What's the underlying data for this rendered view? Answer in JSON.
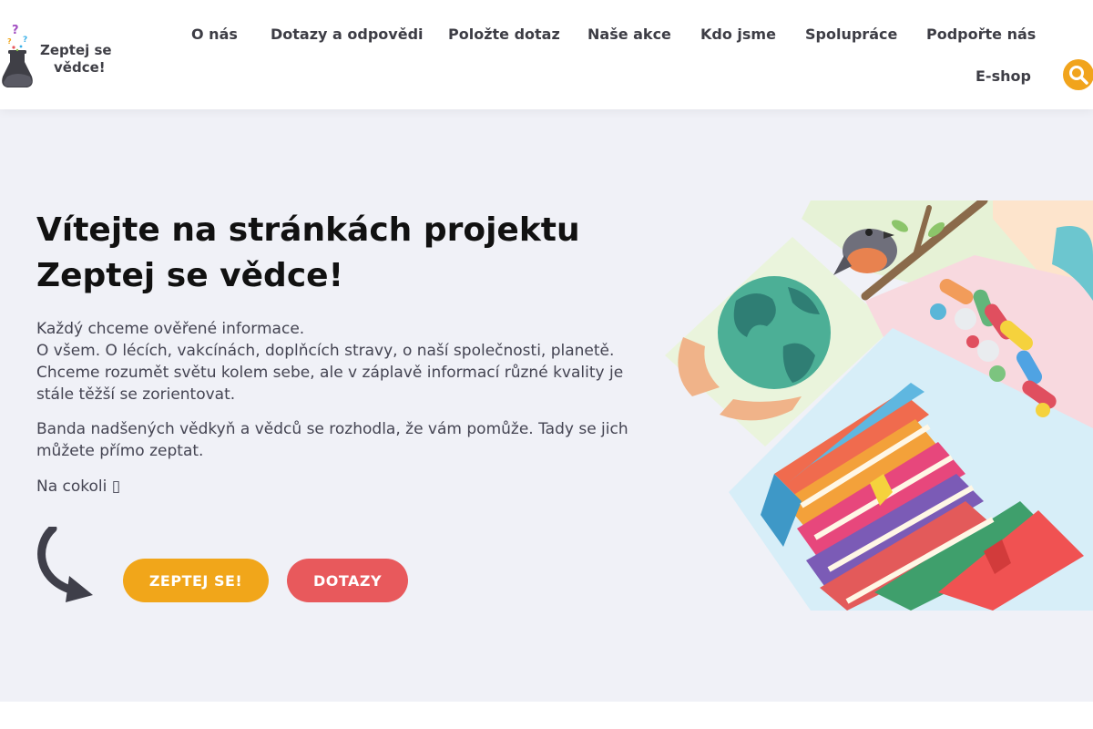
{
  "brand": {
    "name_line1": "Zeptej se",
    "name_line2": "vědce!"
  },
  "nav": {
    "items": [
      {
        "label": "O nás"
      },
      {
        "label": "Dotazy a odpovědi"
      },
      {
        "label": "Položte dotaz"
      },
      {
        "label": "Naše akce"
      },
      {
        "label": "Kdo jsme"
      },
      {
        "label": "Spolupráce"
      },
      {
        "label": "Podpořte nás"
      },
      {
        "label": "E-shop"
      }
    ],
    "search_icon": "search-icon"
  },
  "hero": {
    "title_line1": "Vítejte na stránkách projektu",
    "title_line2": "Zeptej se vědce!",
    "p1_lines": [
      "Každý chceme ověřené informace.",
      "O všem. O lécích, vakcínách, doplňcích stravy, o naší společnosti, planetě.",
      "Chceme rozumět světu kolem sebe, ale v záplavě informací různé kvality je",
      "stále těžší se zorientovat."
    ],
    "p2_lines": [
      "Banda nadšených vědkyň a vědců se rozhodla, že vám pomůže. Tady se jich",
      "můžete přímo zeptat."
    ],
    "p3": "Na cokoli ▯",
    "ask_button": "ZEPTEJ SE!",
    "faq_button": "DOTAZY",
    "arrow_icon": "curved-arrow-icon",
    "illustration": "globe-pills-books-illustration"
  },
  "colors": {
    "accent_orange": "#f1a61a",
    "accent_red": "#e8595c",
    "hero_bg": "#f0f1f7"
  }
}
